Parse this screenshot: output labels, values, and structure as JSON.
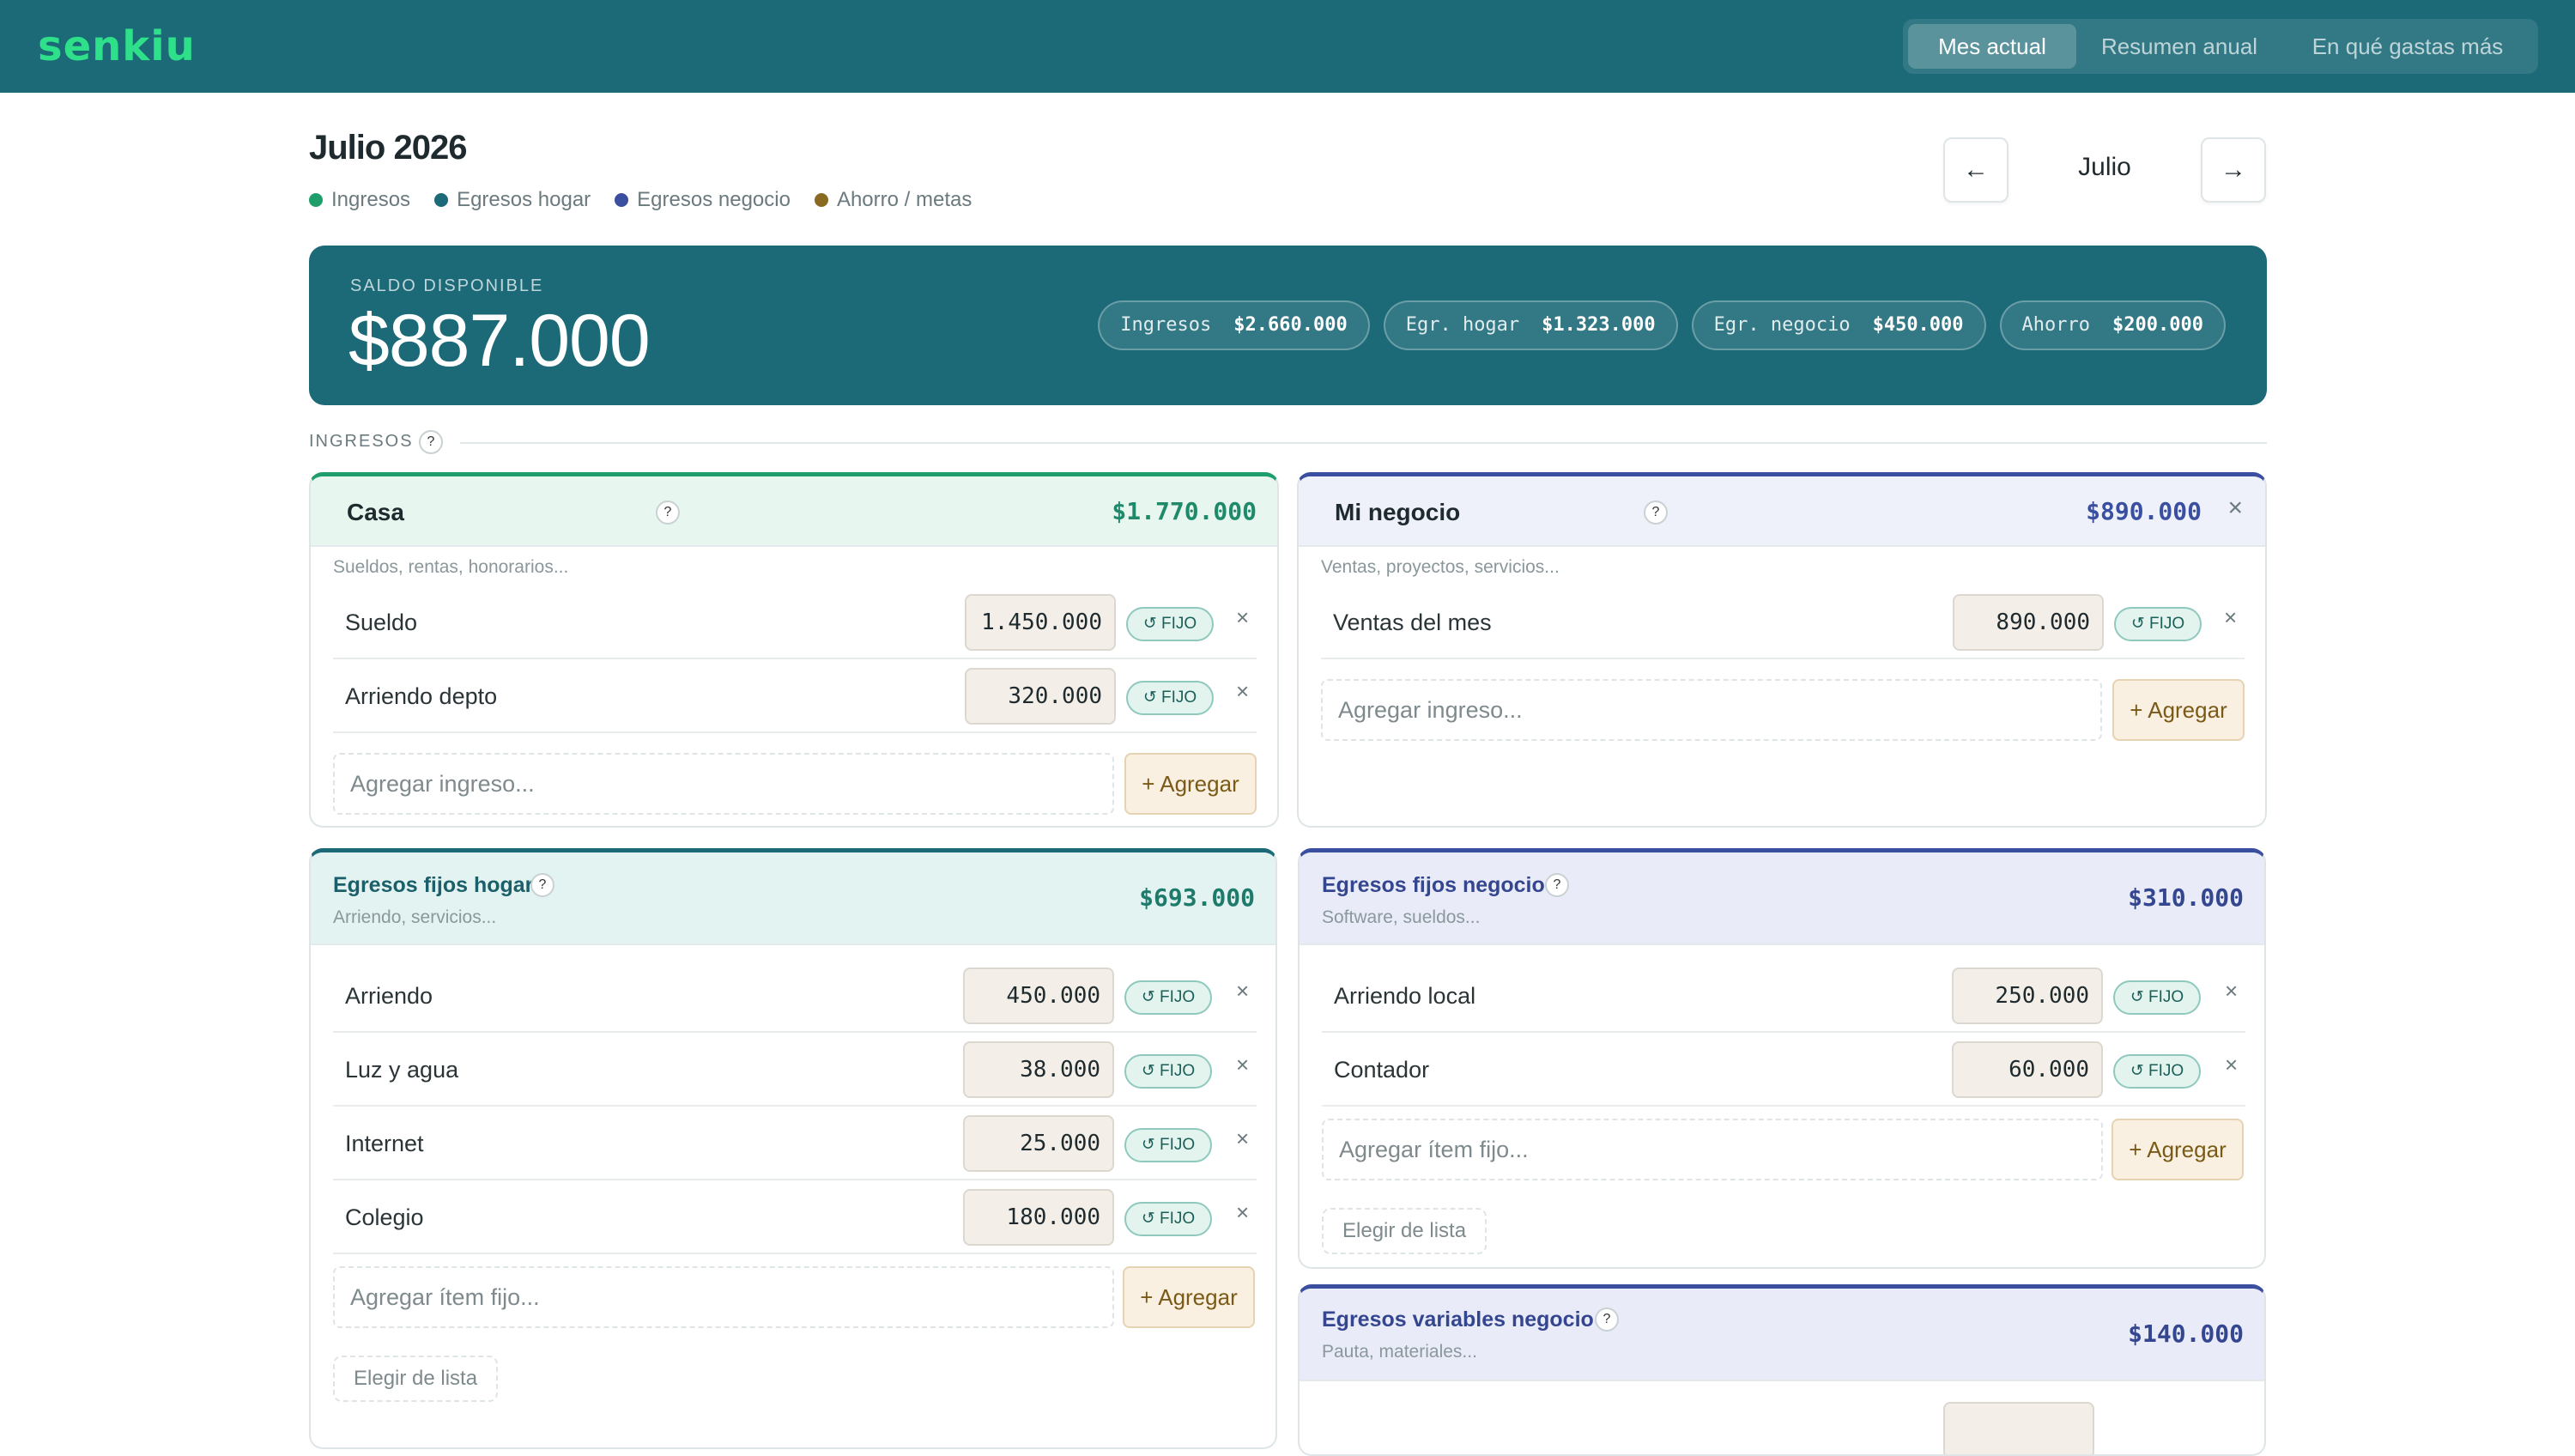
{
  "app": {
    "logo": "senkiu"
  },
  "nav": {
    "tabs": [
      {
        "label": "Mes actual"
      },
      {
        "label": "Resumen anual"
      },
      {
        "label": "En qué gastas más"
      }
    ]
  },
  "header": {
    "title": "Julio 2026",
    "legend": [
      {
        "label": "Ingresos",
        "color": "#1e9e6a"
      },
      {
        "label": "Egresos hogar",
        "color": "#1c6a78"
      },
      {
        "label": "Egresos negocio",
        "color": "#3b4fa0"
      },
      {
        "label": "Ahorro / metas",
        "color": "#8a6a22"
      }
    ],
    "prev_icon": "←",
    "next_icon": "→",
    "month": "Julio"
  },
  "balance": {
    "label": "SALDO DISPONIBLE",
    "value": "$887.000",
    "pills": [
      {
        "label": "Ingresos",
        "value": "$2.660.000"
      },
      {
        "label": "Egr. hogar",
        "value": "$1.323.000"
      },
      {
        "label": "Egr. negocio",
        "value": "$450.000"
      },
      {
        "label": "Ahorro",
        "value": "$200.000"
      }
    ]
  },
  "section": {
    "label": "INGRESOS",
    "help": "?"
  },
  "cards": {
    "casa": {
      "title": "Casa",
      "total": "$1.770.000",
      "help": "?",
      "subtitle": "Sueldos, rentas, honorarios...",
      "rows": [
        {
          "label": "Sueldo",
          "amount": "1.450.000"
        },
        {
          "label": "Arriendo depto",
          "amount": "320.000"
        }
      ],
      "add_placeholder": "Agregar ingreso...",
      "add_label": "+ Agregar"
    },
    "negocio": {
      "title": "Mi negocio",
      "total": "$890.000",
      "help": "?",
      "subtitle": "Ventas, proyectos, servicios...",
      "rows": [
        {
          "label": "Ventas del mes",
          "amount": "890.000"
        }
      ],
      "add_placeholder": "Agregar ingreso...",
      "add_label": "+ Agregar"
    },
    "fijos_hogar": {
      "title": "Egresos fijos hogar",
      "total": "$693.000",
      "help": "?",
      "subtitle": "Arriendo, servicios...",
      "rows": [
        {
          "label": "Arriendo",
          "amount": "450.000"
        },
        {
          "label": "Luz y agua",
          "amount": "38.000"
        },
        {
          "label": "Internet",
          "amount": "25.000"
        },
        {
          "label": "Colegio",
          "amount": "180.000"
        }
      ],
      "add_placeholder": "Agregar ítem fijo...",
      "add_label": "+ Agregar",
      "pick_label": "Elegir de lista"
    },
    "fijos_negocio": {
      "title": "Egresos fijos negocio",
      "total": "$310.000",
      "help": "?",
      "subtitle": "Software, sueldos...",
      "rows": [
        {
          "label": "Arriendo local",
          "amount": "250.000"
        },
        {
          "label": "Contador",
          "amount": "60.000"
        }
      ],
      "add_placeholder": "Agregar ítem fijo...",
      "add_label": "+ Agregar",
      "pick_label": "Elegir de lista"
    },
    "variables_negocio": {
      "title": "Egresos variables negocio",
      "total": "$140.000",
      "help": "?",
      "subtitle": "Pauta, materiales..."
    }
  },
  "common": {
    "fijo_label": "↺ FIJO",
    "remove_icon": "×"
  }
}
